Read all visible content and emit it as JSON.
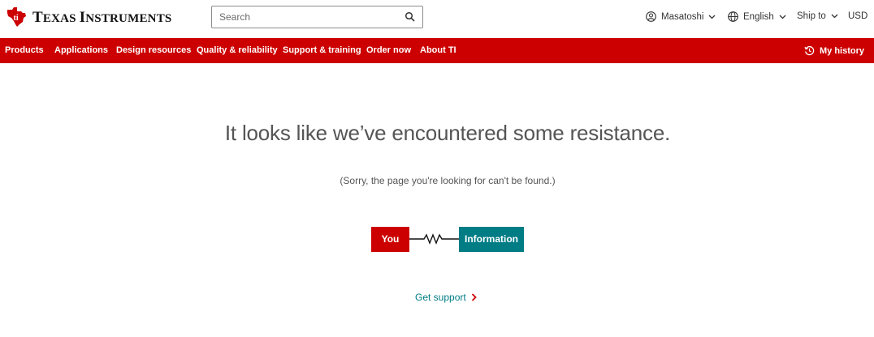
{
  "header": {
    "logo_text_lead": "T",
    "logo_text_rest": "EXAS ",
    "logo_text_lead2": "I",
    "logo_text_rest2": "NSTRUMENTS",
    "logo_icon": "ti-state-logo-icon",
    "search": {
      "placeholder": "Search",
      "value": "",
      "icon": "search-icon"
    },
    "user": {
      "label": "Masatoshi",
      "icon": "user-icon"
    },
    "language": {
      "label": "English",
      "icon": "globe-icon"
    },
    "ship_to": {
      "label": "Ship to"
    },
    "currency": {
      "label": "USD"
    }
  },
  "nav": {
    "items": [
      {
        "label": "Products"
      },
      {
        "label": "Applications"
      },
      {
        "label": "Design resources"
      },
      {
        "label": "Quality & reliability"
      },
      {
        "label": "Support & training"
      },
      {
        "label": "Order now"
      },
      {
        "label": "About TI"
      }
    ],
    "history": {
      "label": "My history",
      "icon": "history-icon"
    }
  },
  "main": {
    "headline": "It looks like we’ve encountered some resistance.",
    "subtext": "(Sorry, the page you're looking for can't be found.)",
    "diagram": {
      "left": "You",
      "right": "Information",
      "connector_icon": "resistor-icon"
    },
    "support_link": "Get support"
  },
  "colors": {
    "brand_red": "#cc0000",
    "teal": "#007c85"
  }
}
